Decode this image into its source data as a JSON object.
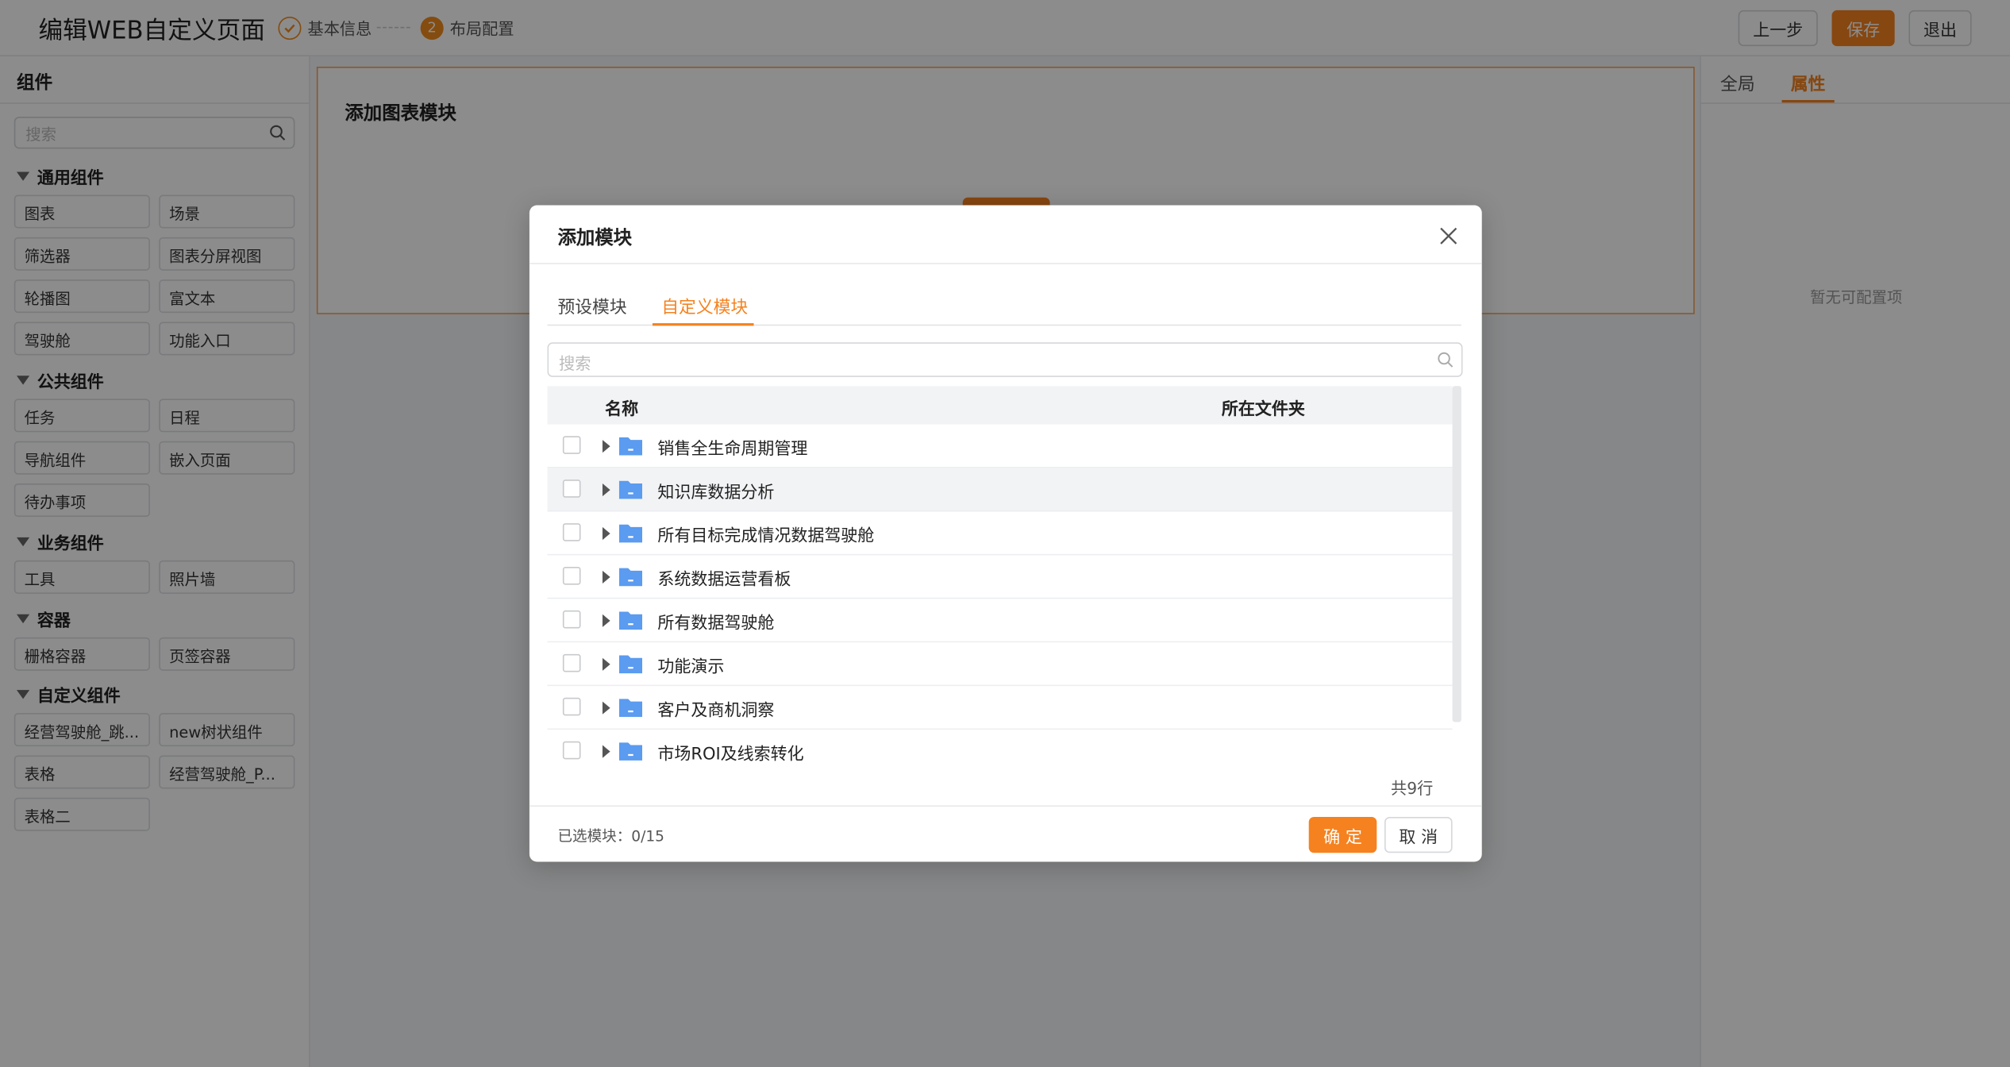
{
  "header": {
    "title": "编辑WEB自定义页面",
    "steps": [
      {
        "label": "基本信息",
        "status": "done"
      },
      {
        "number": "2",
        "label": "布局配置",
        "status": "active"
      }
    ],
    "buttons": {
      "prev": "上一步",
      "save": "保存",
      "exit": "退出"
    }
  },
  "left_panel": {
    "title": "组件",
    "search_placeholder": "搜索",
    "groups": [
      {
        "title": "通用组件",
        "items": [
          "图表",
          "场景",
          "筛选器",
          "图表分屏视图",
          "轮播图",
          "富文本",
          "驾驶舱",
          "功能入口"
        ]
      },
      {
        "title": "公共组件",
        "items": [
          "任务",
          "日程",
          "导航组件",
          "嵌入页面",
          "待办事项"
        ]
      },
      {
        "title": "业务组件",
        "items": [
          "工具",
          "照片墙"
        ]
      },
      {
        "title": "容器",
        "items": [
          "栅格容器",
          "页签容器"
        ]
      },
      {
        "title": "自定义组件",
        "items": [
          "经营驾驶舱_跳...",
          "new树状组件",
          "表格",
          "经营驾驶舱_P...",
          "表格二"
        ]
      }
    ]
  },
  "canvas": {
    "block_title": "添加图表模块"
  },
  "right_panel": {
    "tabs": [
      "全局",
      "属性"
    ],
    "active_tab": "属性",
    "empty_text": "暂无可配置项"
  },
  "modal": {
    "title": "添加模块",
    "tabs": [
      "预设模块",
      "自定义模块"
    ],
    "active_tab": "自定义模块",
    "search_placeholder": "搜索",
    "columns": {
      "name": "名称",
      "folder": "所在文件夹"
    },
    "rows": [
      {
        "name": "销售全生命周期管理"
      },
      {
        "name": "知识库数据分析"
      },
      {
        "name": "所有目标完成情况数据驾驶舱"
      },
      {
        "name": "系统数据运营看板"
      },
      {
        "name": "所有数据驾驶舱"
      },
      {
        "name": "功能演示"
      },
      {
        "name": "客户及商机洞察"
      },
      {
        "name": "市场ROI及线索转化"
      }
    ],
    "total": "共9行",
    "selected": "已选模块：0/15",
    "ok": "确 定",
    "cancel": "取 消"
  },
  "colors": {
    "accent": "#f5821f",
    "folder": "#5b9bf0"
  },
  "icons": {
    "close": "close-icon",
    "search": "search-icon",
    "folder": "folder-icon",
    "check": "check-icon",
    "expand": "caret-right-icon"
  }
}
